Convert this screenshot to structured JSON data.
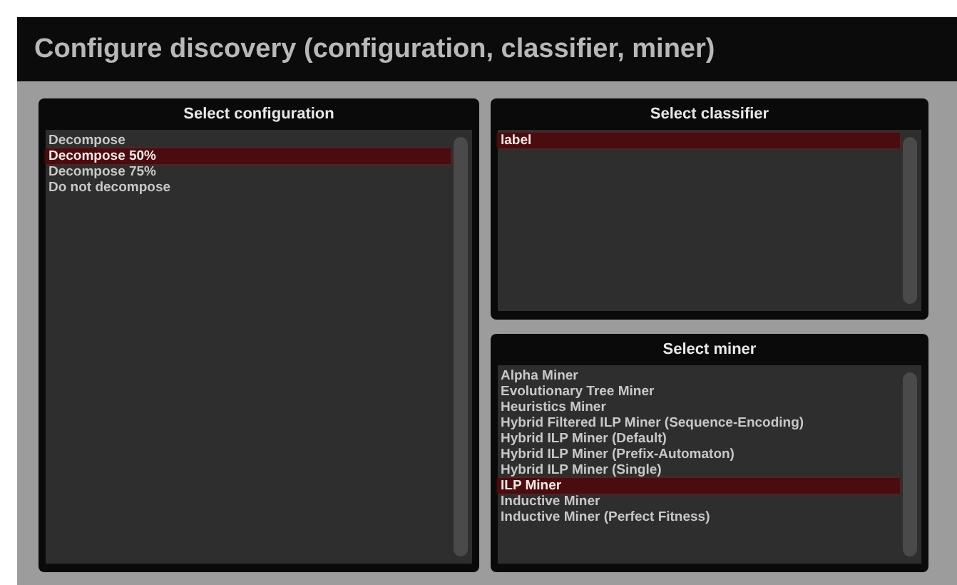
{
  "window": {
    "title": "Configure discovery (configuration, classifier, miner)"
  },
  "panels": [
    {
      "title": "Select configuration",
      "items": [
        {
          "label": "Decompose",
          "selected": false
        },
        {
          "label": "Decompose 50%",
          "selected": true
        },
        {
          "label": "Decompose 75%",
          "selected": false
        },
        {
          "label": "Do not decompose",
          "selected": false
        }
      ]
    },
    {
      "title": "Select classifier",
      "items": [
        {
          "label": "label",
          "selected": true
        }
      ]
    },
    {
      "title": "Select miner",
      "items": [
        {
          "label": "Alpha Miner",
          "selected": false
        },
        {
          "label": "Evolutionary Tree Miner",
          "selected": false
        },
        {
          "label": "Heuristics Miner",
          "selected": false
        },
        {
          "label": "Hybrid Filtered ILP Miner (Sequence-Encoding)",
          "selected": false
        },
        {
          "label": "Hybrid ILP Miner (Default)",
          "selected": false
        },
        {
          "label": "Hybrid ILP Miner (Prefix-Automaton)",
          "selected": false
        },
        {
          "label": "Hybrid ILP Miner (Single)",
          "selected": false
        },
        {
          "label": "ILP Miner",
          "selected": true
        },
        {
          "label": "Inductive Miner",
          "selected": false
        },
        {
          "label": "Inductive Miner (Perfect Fitness)",
          "selected": false
        }
      ]
    }
  ]
}
